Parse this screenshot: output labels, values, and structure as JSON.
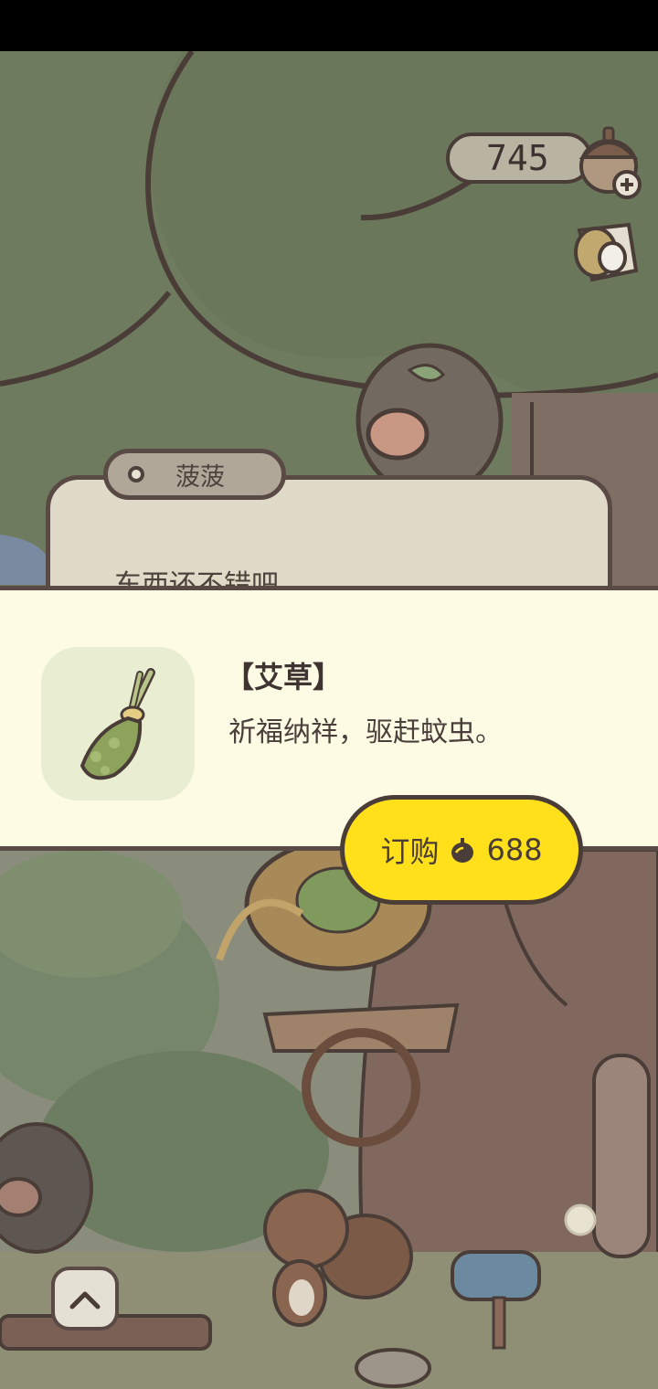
{
  "hud": {
    "acorn_count": "745",
    "acorn_icon": "acorn-plus-icon",
    "cup_icon": "cup-icon"
  },
  "dialog": {
    "speaker": "菠菠",
    "text": "东西还不错吧。"
  },
  "item": {
    "title": "【艾草】",
    "description": "祈福纳祥，驱赶蚊虫。",
    "icon": "mugwort-bundle-icon"
  },
  "order": {
    "label": "订购",
    "price": "688",
    "currency_icon": "acorn-icon",
    "color": "#ffe01b"
  },
  "nav": {
    "up_icon": "chevron-up-icon"
  },
  "colors": {
    "panel_bg": "#fdfbe4",
    "outline": "#5a4a45",
    "foliage": "#6b7a5c"
  }
}
